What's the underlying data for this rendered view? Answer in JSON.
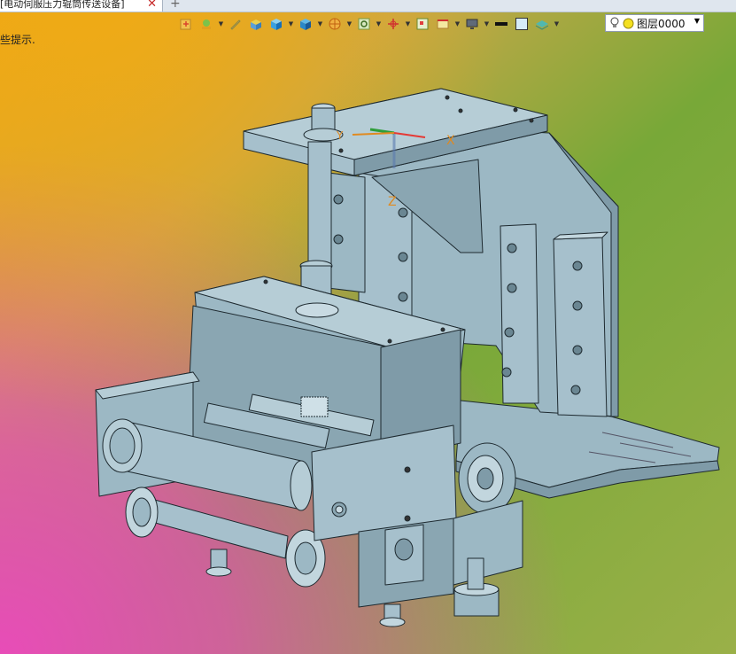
{
  "tab": {
    "title": "[电动伺服压力辊筒传送设备]",
    "close": "✕",
    "add": "+"
  },
  "hint": "些提示.",
  "layer": {
    "name": "图层0000"
  },
  "axes": {
    "x": "X",
    "y": "Y",
    "z": "Z"
  },
  "toolbar": {
    "icons": [
      "open-icon",
      "pan-icon",
      "pencil-icon",
      "box-icon",
      "cube-icon",
      "view-cube-icon",
      "wheel-icon",
      "zoom-icon",
      "axis-icon",
      "frame-icon",
      "measure-icon",
      "display-icon",
      "line-icon",
      "fill-icon",
      "layer-icon"
    ]
  },
  "colors": {
    "model": "#9cb8c4",
    "model_dark": "#7f9ba8",
    "edge": "#1e2a30",
    "accent_red": "#e53935",
    "accent_green": "#2e9e3a"
  }
}
